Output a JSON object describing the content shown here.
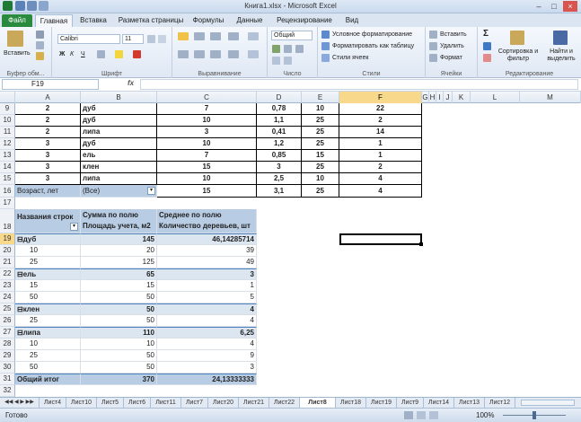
{
  "window": {
    "title": "Книга1.xlsx - Microsoft Excel"
  },
  "tabs": [
    "Файл",
    "Главная",
    "Вставка",
    "Разметка страницы",
    "Формулы",
    "Данные",
    "Рецензирование",
    "Вид"
  ],
  "ribbon": {
    "groups": [
      "Буфер обм...",
      "Шрифт",
      "Выравнивание",
      "Число",
      "Стили",
      "Ячейки",
      "Редактирование"
    ],
    "paste": "Вставить",
    "font_name": "Calibri",
    "font_size": "11",
    "number_format": "Общий",
    "cond_format": "Условное форматирование",
    "format_table": "Форматировать как таблицу",
    "cell_styles": "Стили ячеек",
    "insert": "Вставить",
    "delete": "Удалить",
    "format": "Формат",
    "sort": "Сортировка и фильтр",
    "find": "Найти и выделить",
    "bold": "Ж",
    "italic": "К",
    "underline": "Ч",
    "sum": "Σ"
  },
  "formula_bar": {
    "cell": "F19",
    "fx": "fx",
    "value": ""
  },
  "columns": [
    "A",
    "B",
    "C",
    "D",
    "E",
    "F",
    "G",
    "H",
    "I",
    "J",
    "K",
    "L",
    "M"
  ],
  "data_rows": [
    {
      "n": "9",
      "a": "2",
      "b": "дуб",
      "c": "7",
      "d": "0,78",
      "e": "10",
      "f": "22"
    },
    {
      "n": "10",
      "a": "2",
      "b": "дуб",
      "c": "10",
      "d": "1,1",
      "e": "25",
      "f": "2"
    },
    {
      "n": "11",
      "a": "2",
      "b": "липа",
      "c": "3",
      "d": "0,41",
      "e": "25",
      "f": "14"
    },
    {
      "n": "12",
      "a": "3",
      "b": "дуб",
      "c": "10",
      "d": "1,2",
      "e": "25",
      "f": "1"
    },
    {
      "n": "13",
      "a": "3",
      "b": "ель",
      "c": "7",
      "d": "0,85",
      "e": "15",
      "f": "1"
    },
    {
      "n": "14",
      "a": "3",
      "b": "клен",
      "c": "15",
      "d": "3",
      "e": "25",
      "f": "2"
    },
    {
      "n": "15",
      "a": "3",
      "b": "липа",
      "c": "10",
      "d": "2,5",
      "e": "10",
      "f": "4"
    }
  ],
  "filter_row": {
    "n": "16",
    "a": "Возраст, лет",
    "b": "(Все)",
    "c": "15",
    "d": "3,1",
    "e": "25",
    "f": "4"
  },
  "row17": "17",
  "pivot_header": {
    "n": "18",
    "a": "Названия строк",
    "b1": "Сумма по полю",
    "b2": "Площадь учета, м2",
    "c1": "Среднее по полю",
    "c2": "Количество деревьев, шт"
  },
  "pivot_rows": [
    {
      "n": "19",
      "label": "⊟дуб",
      "b": "145",
      "c": "46,14285714",
      "group": true
    },
    {
      "n": "20",
      "label": "10",
      "b": "20",
      "c": "39",
      "group": false
    },
    {
      "n": "21",
      "label": "25",
      "b": "125",
      "c": "49",
      "group": false
    },
    {
      "n": "22",
      "label": "⊟ель",
      "b": "65",
      "c": "3",
      "group": true
    },
    {
      "n": "23",
      "label": "15",
      "b": "15",
      "c": "1",
      "group": false
    },
    {
      "n": "24",
      "label": "50",
      "b": "50",
      "c": "5",
      "group": false
    },
    {
      "n": "25",
      "label": "⊟клен",
      "b": "50",
      "c": "4",
      "group": true
    },
    {
      "n": "26",
      "label": "25",
      "b": "50",
      "c": "4",
      "group": false
    },
    {
      "n": "27",
      "label": "⊟липа",
      "b": "110",
      "c": "6,25",
      "group": true
    },
    {
      "n": "28",
      "label": "10",
      "b": "10",
      "c": "4",
      "group": false
    },
    {
      "n": "29",
      "label": "25",
      "b": "50",
      "c": "9",
      "group": false
    },
    {
      "n": "30",
      "label": "50",
      "b": "50",
      "c": "3",
      "group": false
    }
  ],
  "pivot_total": {
    "n": "31",
    "label": "Общий итог",
    "b": "370",
    "c": "24,13333333"
  },
  "tail_rows": [
    "32",
    "33"
  ],
  "sheets": [
    "Лист4",
    "Лист10",
    "Лист5",
    "Лист6",
    "Лист11",
    "Лист7",
    "Лист20",
    "Лист21",
    "Лист22",
    "Лист8",
    "Лист18",
    "Лист19",
    "Лист9",
    "Лист14",
    "Лист13",
    "Лист12"
  ],
  "active_sheet": "Лист8",
  "status": {
    "ready": "Готово",
    "zoom": "100%"
  }
}
